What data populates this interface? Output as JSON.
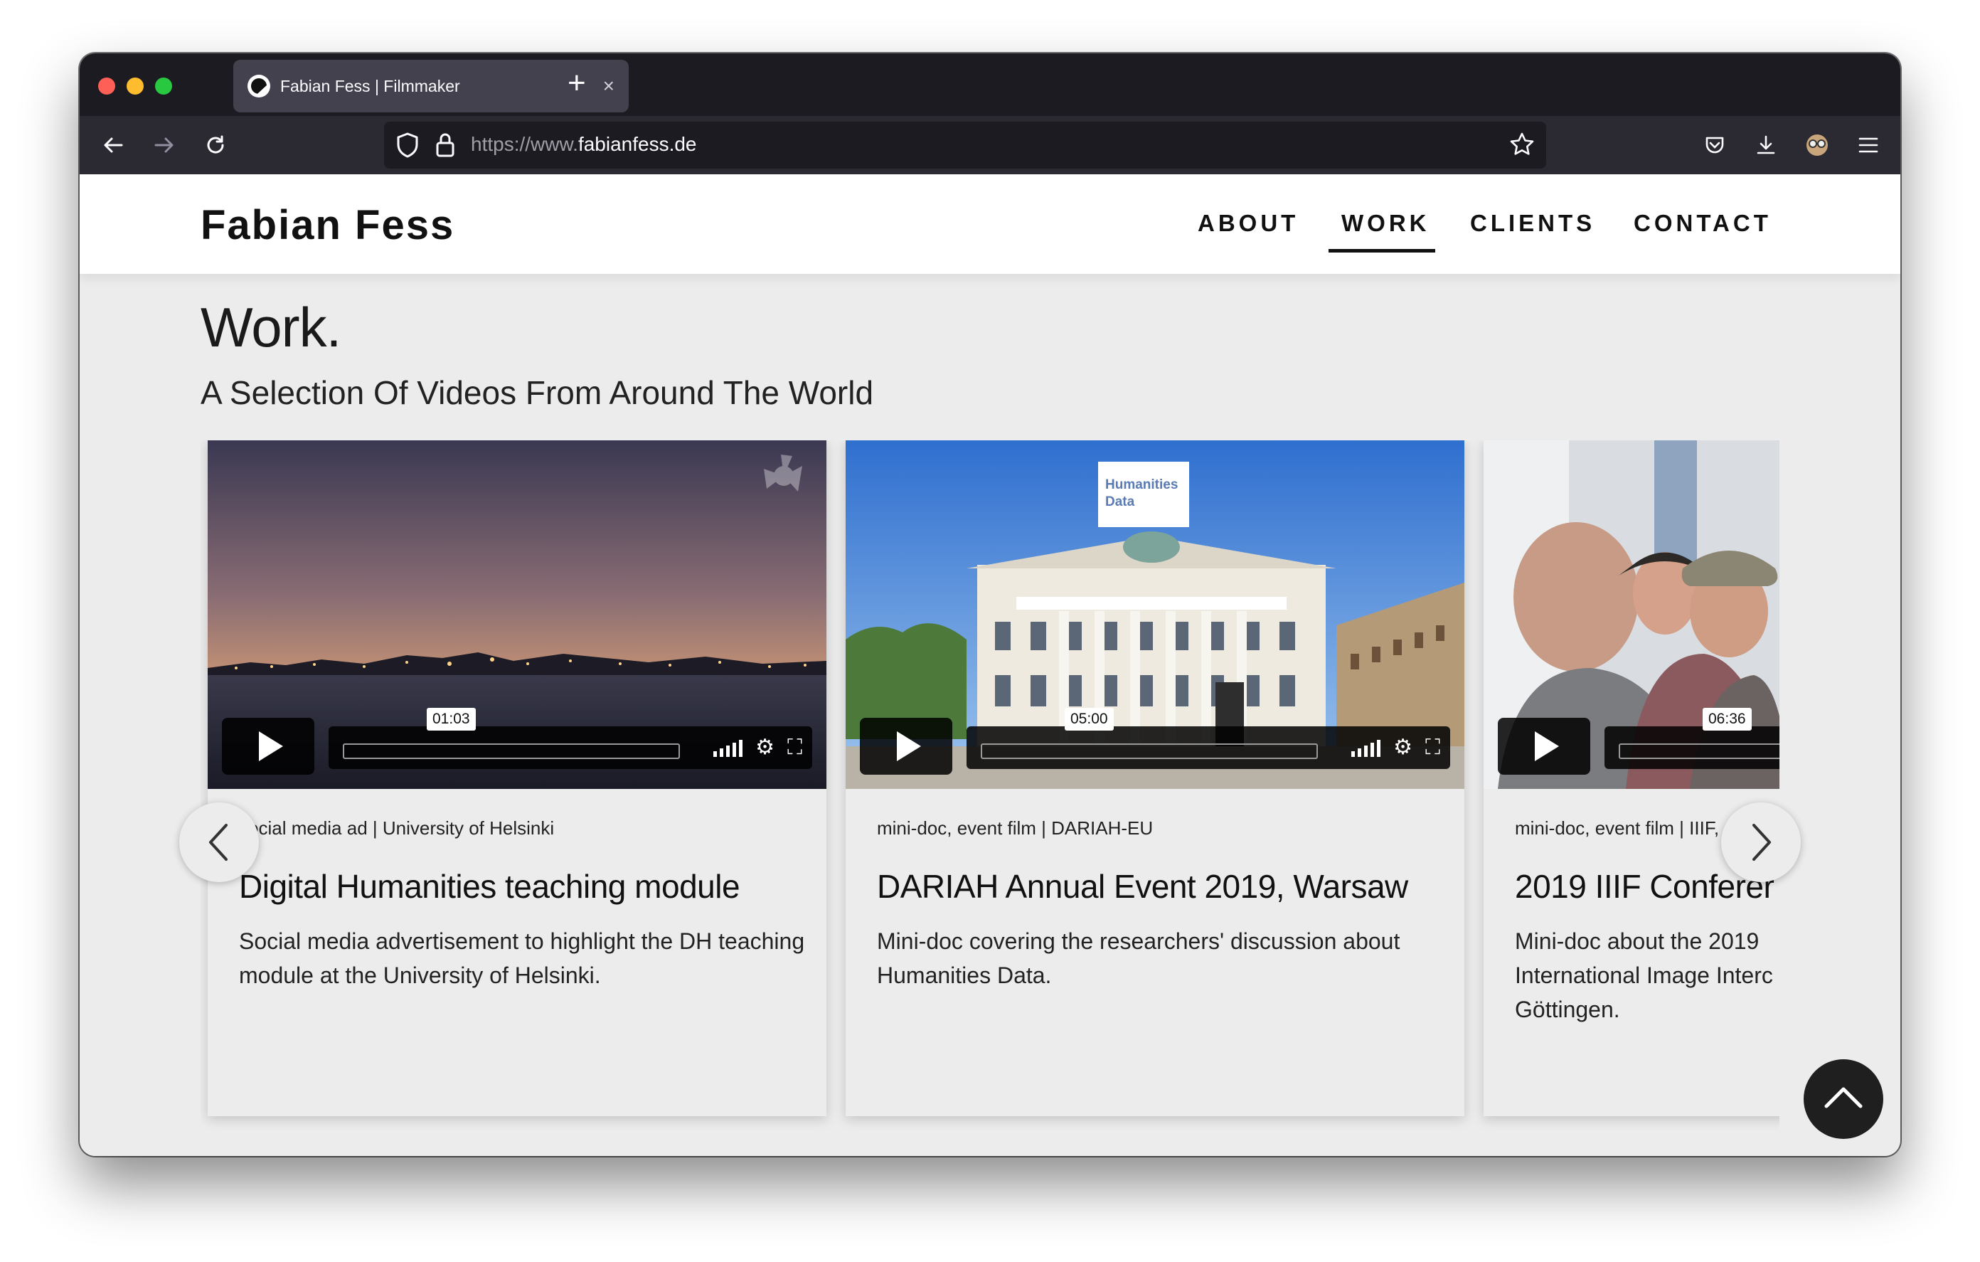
{
  "browser": {
    "tab_title": "Fabian Fess | Filmmaker",
    "url_prefix": "https://www.",
    "url_domain": "fabianfess.de",
    "new_tab_label": "+",
    "close_tab_label": "×"
  },
  "site": {
    "logo": "Fabian Fess",
    "nav": [
      {
        "label": "ABOUT",
        "active": false
      },
      {
        "label": "WORK",
        "active": true
      },
      {
        "label": "CLIENTS",
        "active": false
      },
      {
        "label": "CONTACT",
        "active": false
      }
    ]
  },
  "work": {
    "heading": "Work.",
    "subheading": "A Selection Of Videos From Around The World",
    "cards": [
      {
        "tags": "social media ad | University of Helsinki",
        "title": "Digital Humanities teaching module",
        "description": "Social media advertisement to highlight the DH teaching module at the University of Helsinki.",
        "duration": "01:03"
      },
      {
        "tags": "mini-doc, event film | DARIAH-EU",
        "title": "DARIAH Annual Event 2019, Warsaw",
        "description": "Mini-doc covering the researchers' discussion about Humanities Data.",
        "duration": "05:00",
        "sign_text": "Humanities Data"
      },
      {
        "tags": "mini-doc, event film | IIIF, CLIR,",
        "title": "2019 IIIF Conferer",
        "description": "Mini-doc about the 2019 International Image Interc Göttingen.",
        "duration": "06:36"
      }
    ]
  },
  "colors": {
    "chrome_dark": "#1c1b22",
    "toolbar": "#2b2a33",
    "page_bg": "#ececec",
    "header_bg": "#ffffff",
    "text": "#111111"
  }
}
